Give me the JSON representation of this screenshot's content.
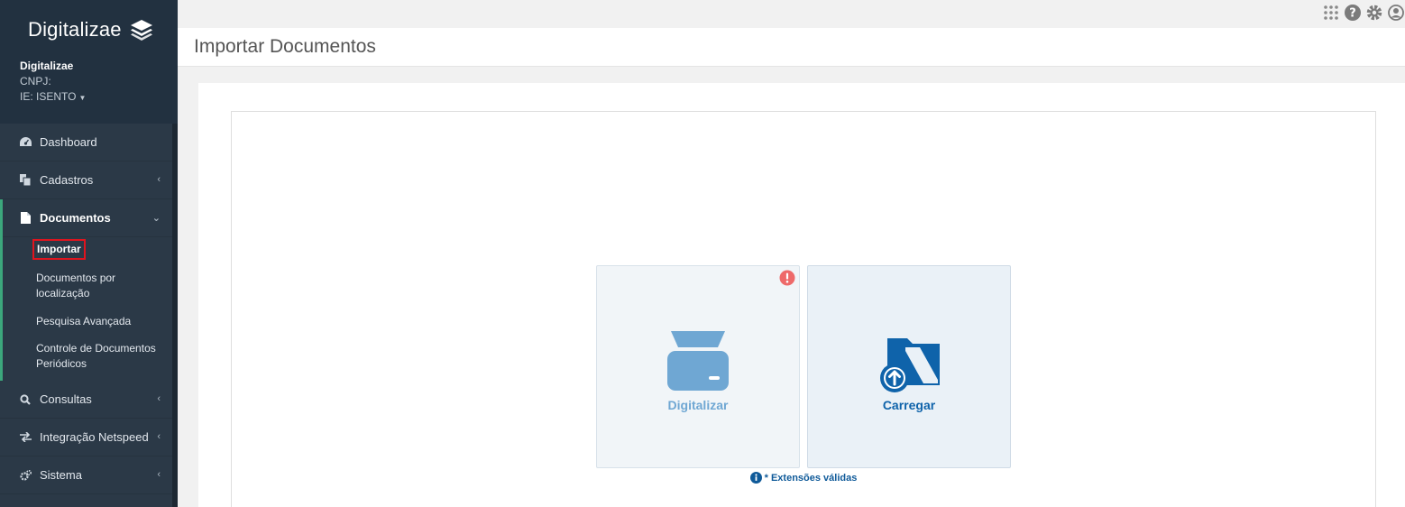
{
  "sidebar": {
    "logo": "Digitalizae",
    "company": {
      "name": "Digitalizae",
      "cnpj": "CNPJ:",
      "ie": "IE: ISENTO"
    },
    "items": [
      {
        "label": "Dashboard",
        "icon": "dashboard-icon"
      },
      {
        "label": "Cadastros",
        "icon": "copy-icon"
      },
      {
        "label": "Documentos",
        "icon": "file-icon"
      },
      {
        "label": "Consultas",
        "icon": "search-icon"
      },
      {
        "label": "Integração Netspeed",
        "icon": "exchange-icon"
      },
      {
        "label": "Sistema",
        "icon": "cogs-icon"
      }
    ],
    "submenu": [
      {
        "label": "Importar"
      },
      {
        "label": "Documentos por localização"
      },
      {
        "label": "Pesquisa Avançada"
      },
      {
        "label": "Controle de Documentos Periódicos"
      }
    ]
  },
  "header": {
    "title": "Importar Documentos"
  },
  "tiles": {
    "scan_label": "Digitalizar",
    "upload_label": "Carregar"
  },
  "extensions_text": "* Extensões válidas",
  "colors": {
    "sidebar_bg": "#2b3947",
    "active_border": "#3ca77c",
    "selected_outline": "#e0141e",
    "scan_blue": "#6fa7d3",
    "upload_blue": "#0f63aa"
  }
}
